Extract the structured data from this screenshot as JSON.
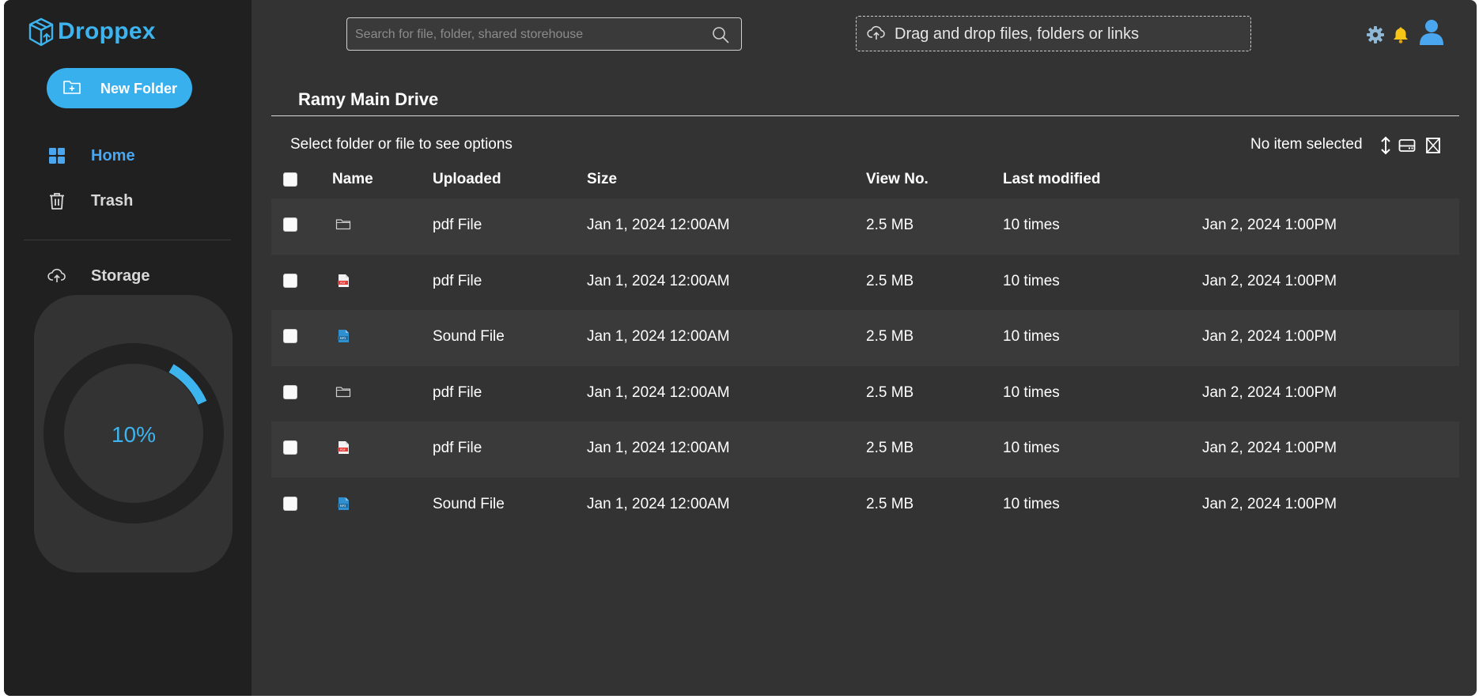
{
  "app": {
    "name": "Droppex"
  },
  "sidebar": {
    "new_folder_label": "New Folder",
    "items": [
      {
        "label": "Home",
        "icon": "grid-icon",
        "active": true
      },
      {
        "label": "Trash",
        "icon": "trash-icon",
        "active": false
      }
    ],
    "storage": {
      "label": "Storage",
      "icon": "cloud-upload-icon",
      "percent_text": "10%",
      "used_fraction": 0.1
    }
  },
  "header": {
    "search": {
      "placeholder": "Search for file, folder, shared storehouse",
      "value": ""
    },
    "dropzone_label": "Drag and drop files, folders or links",
    "icons": [
      "gear-icon",
      "bell-icon",
      "user-icon"
    ]
  },
  "main": {
    "title": "Ramy Main Drive",
    "hint": "Select folder or file to see options",
    "selection_status": "No item selected",
    "columns": [
      "Name",
      "Uploaded",
      "Size",
      "View No.",
      "Last modified"
    ],
    "rows": [
      {
        "icon": "folder-icon",
        "name": "pdf File",
        "uploaded": "Jan 1, 2024 12:00AM",
        "size": "2.5 MB",
        "views": "10 times",
        "modified": "Jan 2, 2024 1:00PM"
      },
      {
        "icon": "pdf-file-icon",
        "name": "pdf File",
        "uploaded": "Jan 1, 2024 12:00AM",
        "size": "2.5 MB",
        "views": "10 times",
        "modified": "Jan 2, 2024 1:00PM"
      },
      {
        "icon": "sound-file-icon",
        "name": "Sound File",
        "uploaded": "Jan 1, 2024 12:00AM",
        "size": "2.5 MB",
        "views": "10 times",
        "modified": "Jan 2, 2024 1:00PM"
      },
      {
        "icon": "folder-icon",
        "name": "pdf File",
        "uploaded": "Jan 1, 2024 12:00AM",
        "size": "2.5 MB",
        "views": "10 times",
        "modified": "Jan 2, 2024 1:00PM"
      },
      {
        "icon": "pdf-file-icon",
        "name": "pdf File",
        "uploaded": "Jan 1, 2024 12:00AM",
        "size": "2.5 MB",
        "views": "10 times",
        "modified": "Jan 2, 2024 1:00PM"
      },
      {
        "icon": "sound-file-icon",
        "name": "Sound File",
        "uploaded": "Jan 1, 2024 12:00AM",
        "size": "2.5 MB",
        "views": "10 times",
        "modified": "Jan 2, 2024 1:00PM"
      }
    ]
  },
  "colors": {
    "accent": "#3eb4ef",
    "active_nav": "#4aa6ee",
    "sidebar_bg": "#202020",
    "main_bg": "#333333"
  }
}
